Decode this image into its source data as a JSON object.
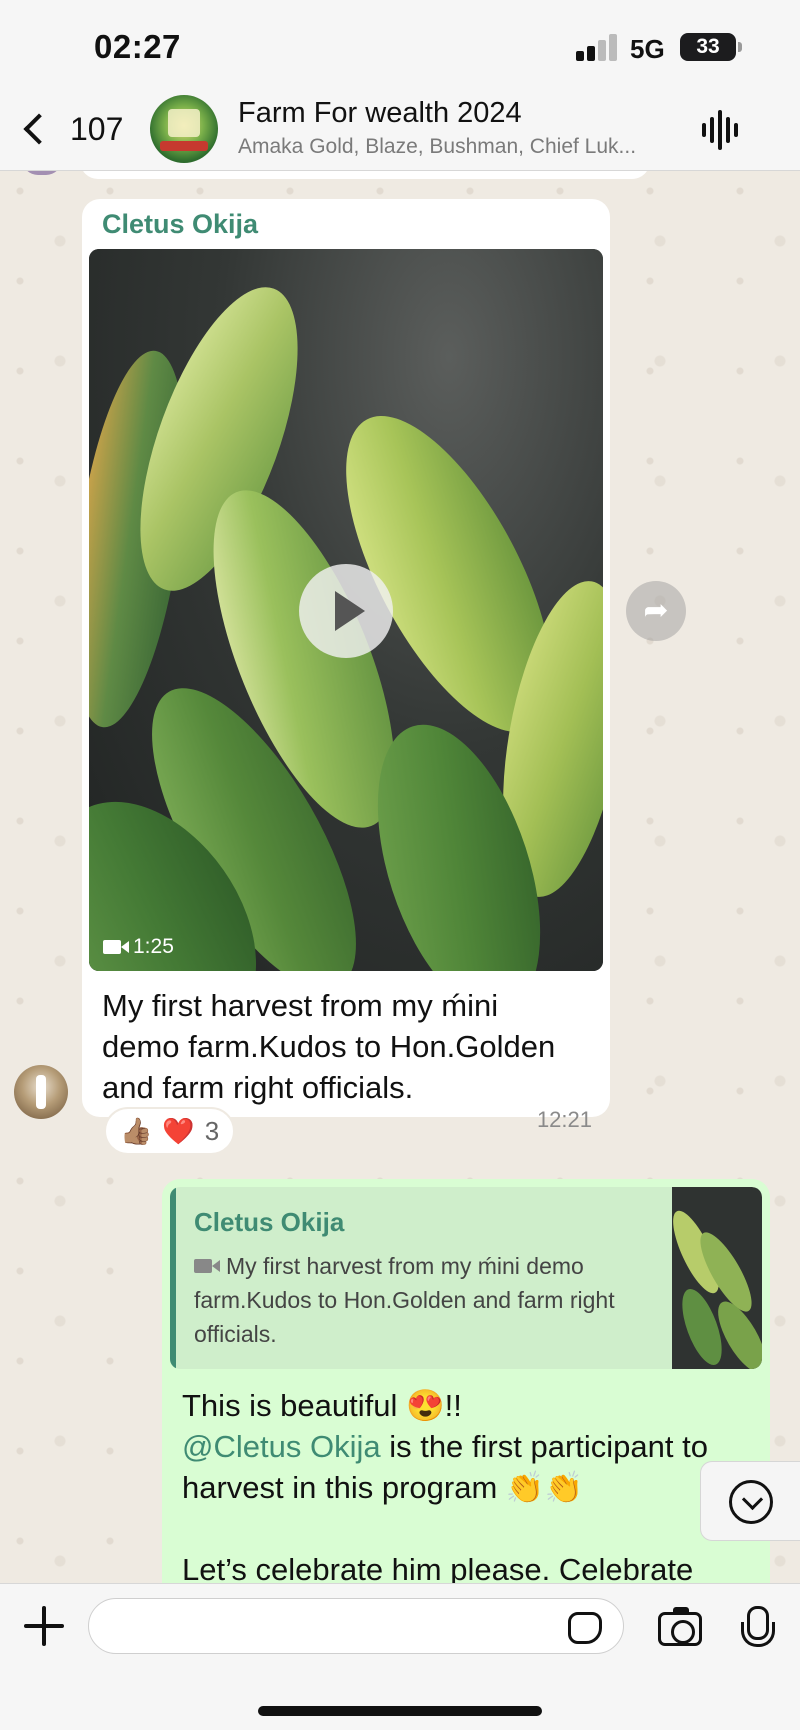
{
  "status_bar": {
    "time": "02:27",
    "network": "5G",
    "battery": "33"
  },
  "header": {
    "back_count": "107",
    "group_title": "Farm For wealth 2024",
    "members": "Amaka Gold, Blaze, Bushman, Chief Luk..."
  },
  "messages": {
    "incoming": {
      "sender": "Cletus Okija",
      "video_duration": "1:25",
      "caption": "My first harvest from my ḿini demo farm.Kudos to Hon.Golden and farm right officials.",
      "time": "12:21",
      "reactions": {
        "emojis": [
          "👍🏽",
          "❤️"
        ],
        "count": "3"
      }
    },
    "outgoing": {
      "quote_sender": "Cletus Okija",
      "quote_text": "My first harvest from my ḿini demo farm.Kudos to Hon.Golden and farm right officials.",
      "line1": "This is beautiful 😍!!",
      "mention": "@Cletus Okija",
      "line2_after_mention": " is the first participant to harvest in this program 👏👏",
      "line3": "Let’s celebrate him please. Celebrate"
    }
  },
  "icons": {
    "back": "chevron-left-icon",
    "voice_call": "waveform-icon",
    "play": "play-icon",
    "forward": "forward-icon",
    "scroll_down": "chevron-down-circle-icon",
    "attach": "plus-icon",
    "sticker": "sticker-icon",
    "camera": "camera-icon",
    "mic": "microphone-icon"
  },
  "colors": {
    "chat_bg": "#efeae2",
    "incoming_bubble": "#ffffff",
    "outgoing_bubble": "#d9fdd3",
    "sender_name": "#3f8b73",
    "bars": "#f6f6f6"
  }
}
